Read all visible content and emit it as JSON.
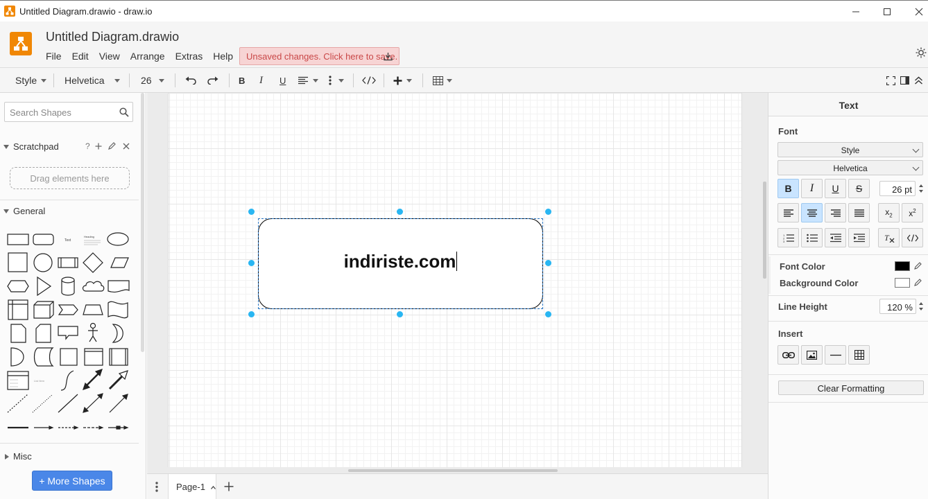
{
  "window": {
    "title": "Untitled Diagram.drawio - draw.io"
  },
  "header": {
    "file_title": "Untitled Diagram.drawio",
    "menu": [
      "File",
      "Edit",
      "View",
      "Arrange",
      "Extras",
      "Help"
    ],
    "unsaved_notice": "Unsaved changes. Click here to save."
  },
  "toolbar": {
    "style_label": "Style",
    "font_name": "Helvetica",
    "font_size": "26"
  },
  "sidebar": {
    "search_placeholder": "Search Shapes",
    "scratchpad_title": "Scratchpad",
    "scratchpad_help": "?",
    "drag_hint": "Drag elements here",
    "general_title": "General",
    "misc_title": "Misc",
    "more_shapes_label": "+ More Shapes",
    "shape_text_sample": "Text",
    "shape_heading_sample": "Heading"
  },
  "canvas": {
    "shape_text": "indiriste.com"
  },
  "pages": {
    "current_tab": "Page-1"
  },
  "format_panel": {
    "title": "Text",
    "font_section": "Font",
    "style_select": "Style",
    "font_select": "Helvetica",
    "font_size_value": "26 pt",
    "font_color_label": "Font Color",
    "background_color_label": "Background Color",
    "font_color": "#000000",
    "background_color": "#ffffff",
    "line_height_label": "Line Height",
    "line_height_value": "120 %",
    "insert_section": "Insert",
    "clear_formatting_label": "Clear Formatting"
  },
  "colors": {
    "accent": "#f08705",
    "selection": "#29b6f2",
    "unsaved_text": "#c94747",
    "more_shapes_bg": "#4a87e8"
  }
}
